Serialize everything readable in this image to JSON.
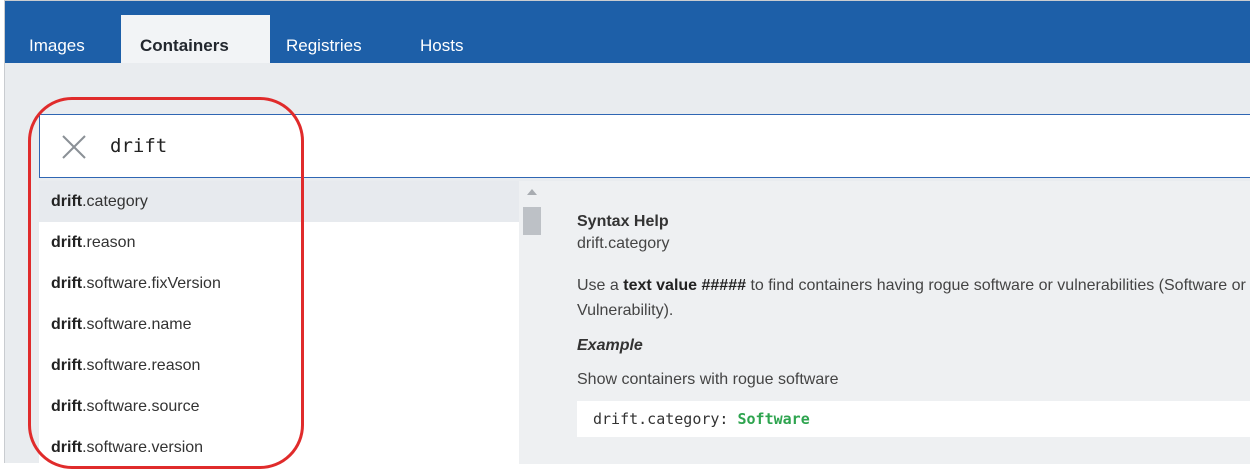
{
  "nav": {
    "tabs": [
      {
        "label": "Images"
      },
      {
        "label": "Containers"
      },
      {
        "label": "Registries"
      },
      {
        "label": "Hosts"
      }
    ]
  },
  "search": {
    "value": "drift",
    "clear_icon": "close-icon"
  },
  "suggestions": [
    {
      "prefix": "drift",
      "suffix": ".category"
    },
    {
      "prefix": "drift",
      "suffix": ".reason"
    },
    {
      "prefix": "drift",
      "suffix": ".software.fixVersion"
    },
    {
      "prefix": "drift",
      "suffix": ".software.name"
    },
    {
      "prefix": "drift",
      "suffix": ".software.reason"
    },
    {
      "prefix": "drift",
      "suffix": ".software.source"
    },
    {
      "prefix": "drift",
      "suffix": ".software.version"
    }
  ],
  "help": {
    "title": "Syntax Help",
    "field": "drift.category",
    "desc_pre": "Use a ",
    "desc_bold": "text value #####",
    "desc_post": " to find containers having rogue software or vulnerabilities (Software or Vulnerability).",
    "example_title": "Example",
    "example_desc": "Show containers with rogue software",
    "code_key": "drift.category: ",
    "code_value": "Software"
  },
  "colors": {
    "nav_bg": "#1d5fa8",
    "annotation": "#e02b2b",
    "code_value": "#2ea44f"
  }
}
